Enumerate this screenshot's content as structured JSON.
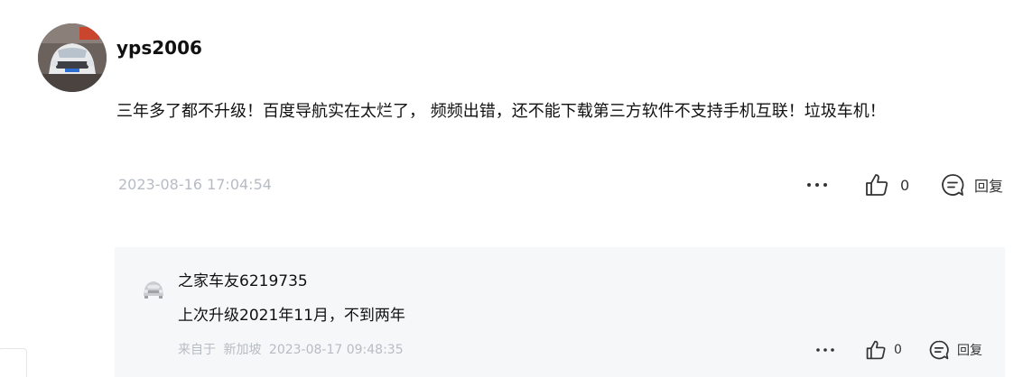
{
  "comment": {
    "username": "yps2006",
    "text": "三年多了都不升级！百度导航实在太烂了， 频频出错，还不能下载第三方软件不支持手机互联！垃圾车机！",
    "timestamp": "2023-08-16 17:04:54",
    "like_count": "0",
    "reply_label": "回复",
    "icons": {
      "avatar": "car-photo-avatar",
      "more": "more-dots-icon",
      "like": "thumbs-up-icon",
      "reply": "reply-bubble-icon"
    }
  },
  "reply": {
    "username": "之家车友6219735",
    "text": "上次升级2021年11月，不到两年",
    "source_prefix": "来自于",
    "location": "新加坡",
    "timestamp": "2023-08-17 09:48:35",
    "like_count": "0",
    "reply_label": "回复",
    "icons": {
      "avatar": "default-car-avatar-icon",
      "more": "more-dots-icon",
      "like": "thumbs-up-icon",
      "reply": "reply-bubble-icon"
    }
  },
  "colors": {
    "meta_gray": "#b7bcc4",
    "reply_background": "#f6f7f9",
    "text": "#111111"
  }
}
